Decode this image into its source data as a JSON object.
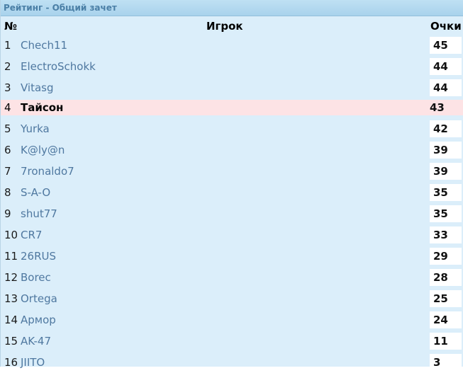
{
  "title": "Рейтинг - Общий зачет",
  "columns": {
    "num": "№",
    "player": "Игрок",
    "points": "Очки"
  },
  "rows": [
    {
      "num": "1",
      "player": "Chech11",
      "points": "45"
    },
    {
      "num": "2",
      "player": "ElectroSchokk",
      "points": "44"
    },
    {
      "num": "3",
      "player": "Vitasg",
      "points": "44"
    },
    {
      "num": "4",
      "player": "Тайсон",
      "points": "43",
      "highlighted": true
    },
    {
      "num": "5",
      "player": "Yurka",
      "points": "42"
    },
    {
      "num": "6",
      "player": "K@ly@n",
      "points": "39"
    },
    {
      "num": "7",
      "player": "7ronaldo7",
      "points": "39"
    },
    {
      "num": "8",
      "player": "S-A-O",
      "points": "35"
    },
    {
      "num": "9",
      "player": "shut77",
      "points": "35"
    },
    {
      "num": "10",
      "player": "CR7",
      "points": "33"
    },
    {
      "num": "11",
      "player": "26RUS",
      "points": "29"
    },
    {
      "num": "12",
      "player": "Borec",
      "points": "28"
    },
    {
      "num": "13",
      "player": "Ortega",
      "points": "25"
    },
    {
      "num": "14",
      "player": "Армор",
      "points": "24"
    },
    {
      "num": "15",
      "player": "AK-47",
      "points": "11"
    },
    {
      "num": "16",
      "player": "JIITO",
      "points": "3"
    }
  ],
  "colors": {
    "panel_bg": "#dbeefa",
    "title_text": "#4a7fa6",
    "player_link": "#4f78a0",
    "highlight_row": "#fde3e5"
  }
}
